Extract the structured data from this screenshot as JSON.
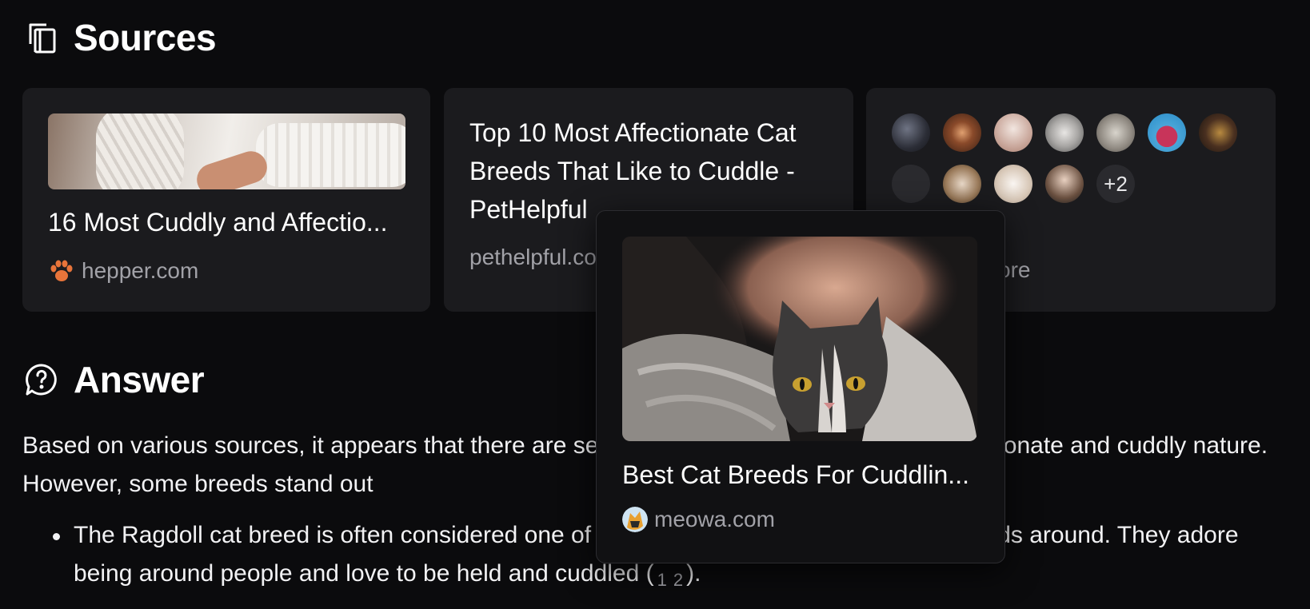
{
  "sources": {
    "title": "Sources",
    "cards": [
      {
        "title": "16 Most Cuddly and Affectio...",
        "domain": "hepper.com",
        "icon": "paw-icon"
      },
      {
        "title": "Top 10 Most Affectionate Cat Breeds That Like to Cuddle - PetHelpful",
        "domain": "pethelpful.com"
      },
      {
        "more_count": "+2",
        "more_label": "View more",
        "visible_fragment": "ore"
      }
    ]
  },
  "answer": {
    "title": "Answer",
    "paragraph": "Based on various sources, it appears that there are several cat breeds known for their affectionate and cuddly nature. However, some breeds stand out",
    "bullets": [
      {
        "text": "The Ragdoll cat breed is often considered one of the most affectionate and cuddly breeds around. They adore being around people and love to be held and cuddled (",
        "citations": [
          "1",
          "2"
        ],
        "end": ")."
      }
    ]
  },
  "popover": {
    "title": "Best Cat Breeds For Cuddlin...",
    "domain": "meowa.com",
    "icon": "meowa-logo-icon"
  },
  "colors": {
    "background": "#0b0b0d",
    "card": "#1b1b1e",
    "muted_text": "#a2a2a8",
    "paw_orange": "#e8743a"
  }
}
